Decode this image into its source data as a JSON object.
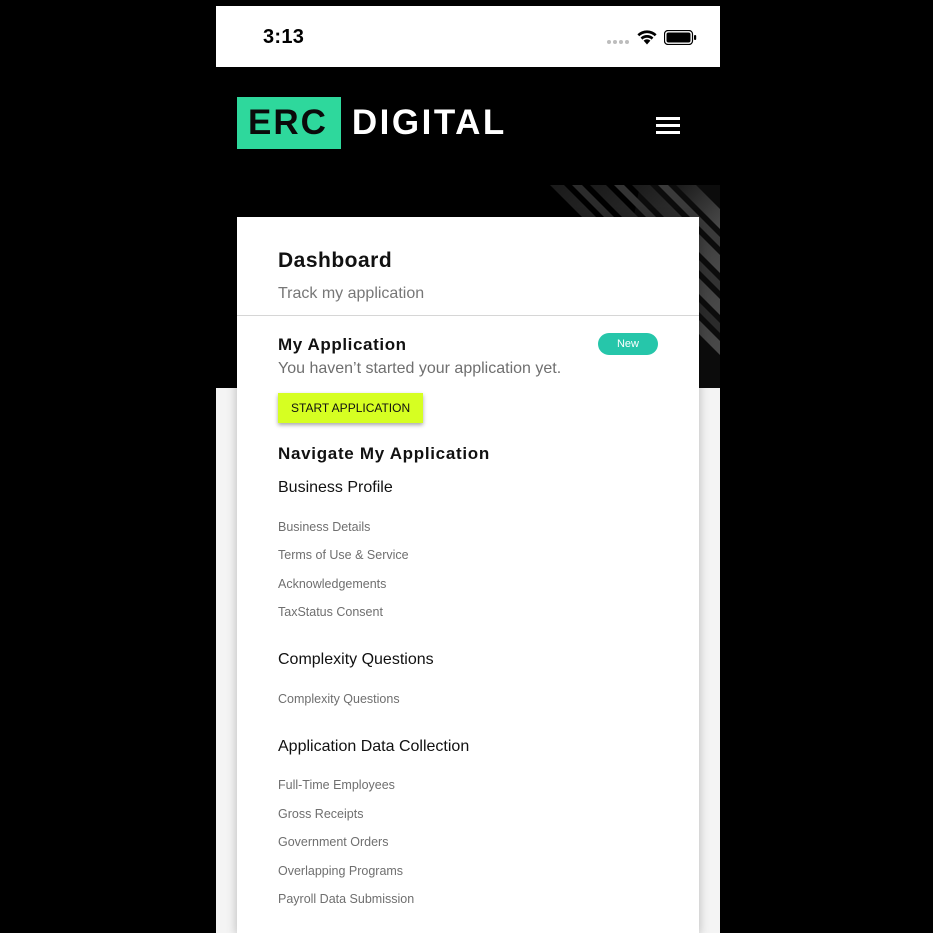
{
  "status_bar": {
    "time": "3:13",
    "icons": [
      "signal-dots-icon",
      "wifi-icon",
      "battery-icon"
    ]
  },
  "header": {
    "logo_part1": "ERC",
    "logo_part2": "DIGITAL",
    "menu_icon": "hamburger-menu-icon"
  },
  "colors": {
    "brand_green": "#2ed89c",
    "button_yellow": "#d6ff22",
    "badge_teal": "#26c6aa"
  },
  "dashboard": {
    "title": "Dashboard",
    "subtitle": "Track my application"
  },
  "my_application": {
    "title": "My Application",
    "badge": "New",
    "message": "You haven’t started your application yet.",
    "start_button": "START APPLICATION"
  },
  "navigate": {
    "title": "Navigate My Application",
    "groups": [
      {
        "title": "Business Profile",
        "items": [
          "Business Details",
          "Terms of Use & Service",
          "Acknowledgements",
          "TaxStatus Consent"
        ]
      },
      {
        "title": "Complexity Questions",
        "items": [
          "Complexity Questions"
        ]
      },
      {
        "title": "Application Data Collection",
        "items": [
          "Full-Time Employees",
          "Gross Receipts",
          "Government Orders",
          "Overlapping Programs",
          "Payroll Data Submission"
        ]
      }
    ]
  }
}
